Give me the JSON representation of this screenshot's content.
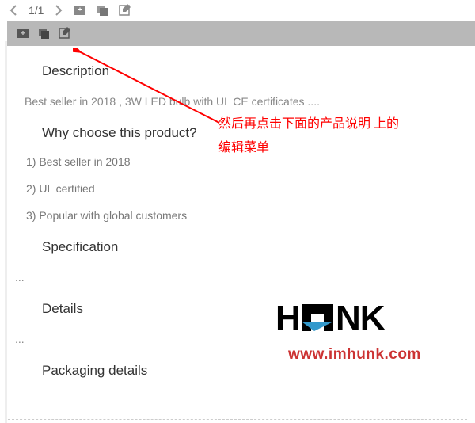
{
  "toolbar": {
    "page_indicator": "1/1"
  },
  "sections": {
    "description": {
      "title": "Description",
      "text": "Best seller in 2018 , 3W LED bulb with UL CE certificates ...."
    },
    "why_choose": {
      "title": "Why choose this product?",
      "items": [
        "1) Best seller in 2018",
        "2) UL certified",
        "3) Popular with global customers"
      ]
    },
    "specification": {
      "title": "Specification",
      "text": "..."
    },
    "details": {
      "title": "Details",
      "text": "..."
    },
    "packaging": {
      "title": "Packaging details"
    }
  },
  "annotation": {
    "line1": "然后再点击下面的产品说明 上的",
    "line2": "编辑菜单"
  },
  "logo": {
    "url": "www.imhunk.com"
  }
}
